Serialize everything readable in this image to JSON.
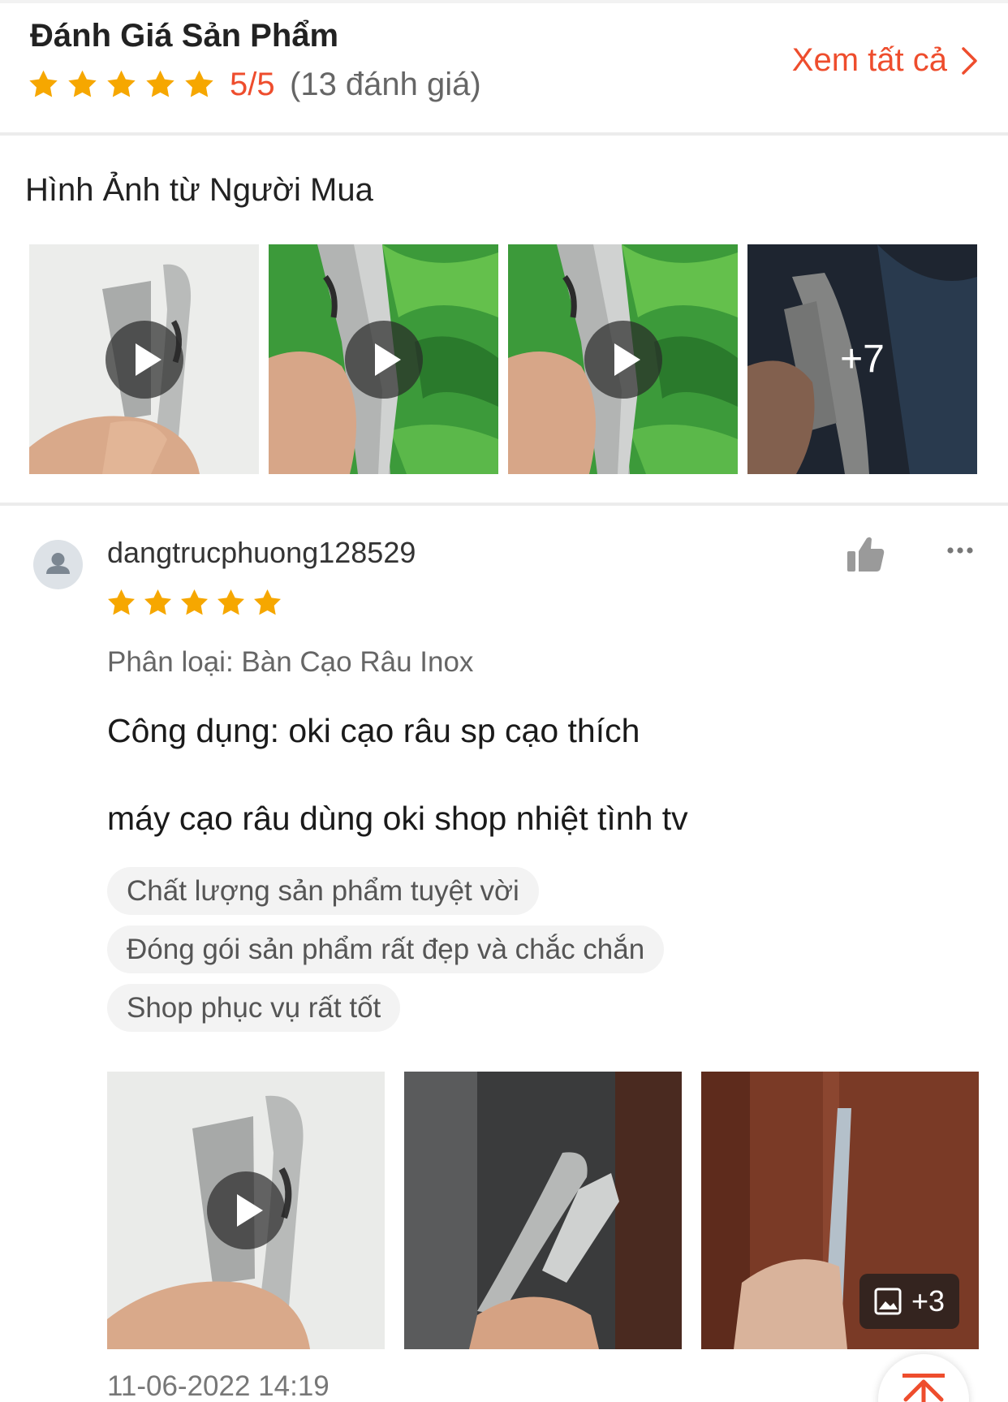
{
  "header": {
    "title": "Đánh Giá Sản Phẩm",
    "rating": "5/5",
    "review_count": "(13 đánh giá)",
    "see_all": "Xem tất cả",
    "star_color": "#f6a700",
    "accent_color": "#ee4d2d"
  },
  "buyer_images": {
    "title": "Hình Ảnh từ Người Mua",
    "more_count": "+7"
  },
  "review": {
    "username": "dangtrucphuong128529",
    "stars": 5,
    "variation": "Phân loại: Bàn Cạo Râu Inox",
    "comment_line1": "Công dụng: oki cạo râu sp cạo thích",
    "comment_line2": "máy cạo râu dùng oki shop nhiệt tình tv",
    "tags": [
      "Chất lượng sản phẩm tuyệt vời",
      "Đóng gói sản phẩm rất đẹp và chắc chắn",
      "Shop phục vụ rất tốt"
    ],
    "media_more_count": "+3",
    "timestamp": "11-06-2022 14:19"
  },
  "icons": {
    "like": "thumbs-up-icon",
    "more": "more-dots-icon",
    "play": "play-icon",
    "gallery": "image-icon",
    "back_to_top": "arrow-up-icon",
    "avatar": "user-avatar-icon",
    "chevron": "chevron-right-icon"
  }
}
